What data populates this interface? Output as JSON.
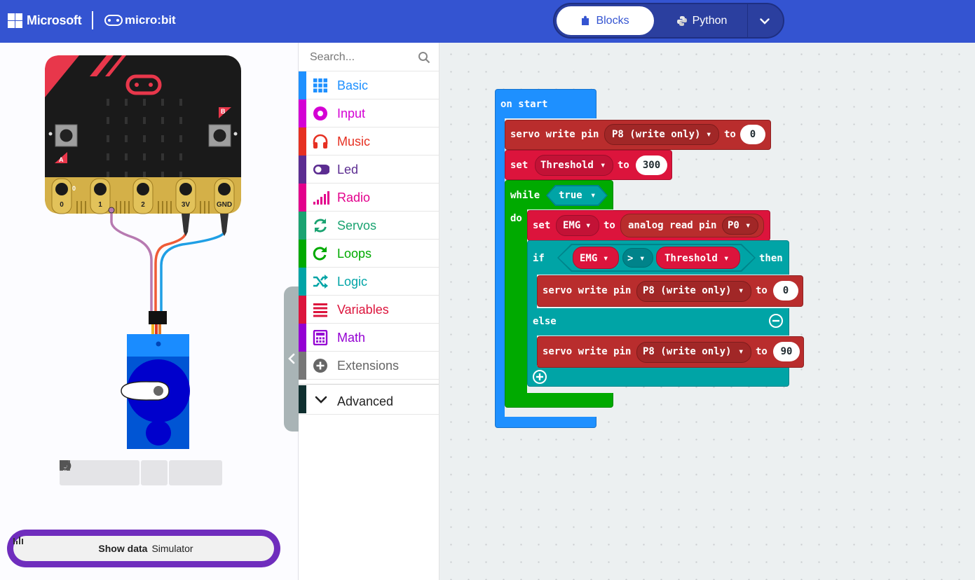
{
  "header": {
    "brand": "Microsoft",
    "product": "micro:bit",
    "tabs": [
      {
        "label": "Blocks",
        "active": true
      },
      {
        "label": "Python",
        "active": false
      }
    ],
    "colors": {
      "header": "#3454d1"
    }
  },
  "simulator": {
    "board": {
      "button_a": "A",
      "button_b": "B",
      "pin_labels": [
        "0",
        "1",
        "2",
        "3V",
        "GND"
      ],
      "pin_0_reading": "0"
    },
    "toolbar": [
      "stop-icon",
      "restart-icon",
      "debug-icon",
      "mute-icon",
      "screenshot-icon",
      "fullscreen-icon"
    ],
    "show_data_label": "Show data",
    "show_data_suffix": "Simulator"
  },
  "toolbox": {
    "search_placeholder": "Search...",
    "categories": [
      {
        "label": "Basic",
        "color": "#1e90ff",
        "icon": "grid-icon"
      },
      {
        "label": "Input",
        "color": "#d400d4",
        "icon": "input-icon"
      },
      {
        "label": "Music",
        "color": "#e63022",
        "icon": "headphones-icon"
      },
      {
        "label": "Led",
        "color": "#5c2d91",
        "icon": "toggle-icon"
      },
      {
        "label": "Radio",
        "color": "#e3008c",
        "icon": "signal-icon"
      },
      {
        "label": "Servos",
        "color": "#1aa371",
        "icon": "refresh-icon"
      },
      {
        "label": "Loops",
        "color": "#00aa00",
        "icon": "loop-icon"
      },
      {
        "label": "Logic",
        "color": "#00a4a6",
        "icon": "shuffle-icon"
      },
      {
        "label": "Variables",
        "color": "#dc143c",
        "icon": "lines-icon"
      },
      {
        "label": "Math",
        "color": "#9400d3",
        "icon": "calculator-icon"
      },
      {
        "label": "Extensions",
        "color": "#777777",
        "icon": "plus-circle-icon"
      }
    ],
    "advanced_label": "Advanced"
  },
  "workspace": {
    "on_start": "on start",
    "servo_write": "servo write pin",
    "to": "to",
    "set": "set",
    "servo_pin": "P8 (write only)",
    "init_value": "0",
    "threshold_var": "Threshold",
    "threshold_value": "300",
    "while": "while",
    "true_label": "true",
    "do": "do",
    "emg_var": "EMG",
    "analog_read": "analog read pin",
    "analog_pin": "P0",
    "if": "if",
    "comparator": ">",
    "then": "then",
    "else": "else",
    "if_value": "0",
    "else_value": "90",
    "colors": {
      "event": "#1e90ff",
      "servo": "#b92d2d",
      "variables": "#dc143c",
      "loops": "#00aa00",
      "logic": "#00a4a6"
    }
  }
}
